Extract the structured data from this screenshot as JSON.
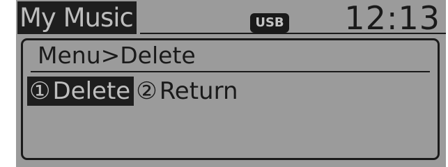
{
  "header": {
    "title": "My Music",
    "source_badge": "USB",
    "clock": "12:13"
  },
  "panel": {
    "breadcrumb": "Menu>Delete",
    "options": [
      {
        "number": "①",
        "label": "Delete",
        "selected": true
      },
      {
        "number": "②",
        "label": "Return",
        "selected": false
      }
    ]
  },
  "colors": {
    "screen_background": "#9b9b9b",
    "ink": "#1a1a1a",
    "highlight_background": "#1e1e1e",
    "highlight_text": "#bfbfbf"
  }
}
